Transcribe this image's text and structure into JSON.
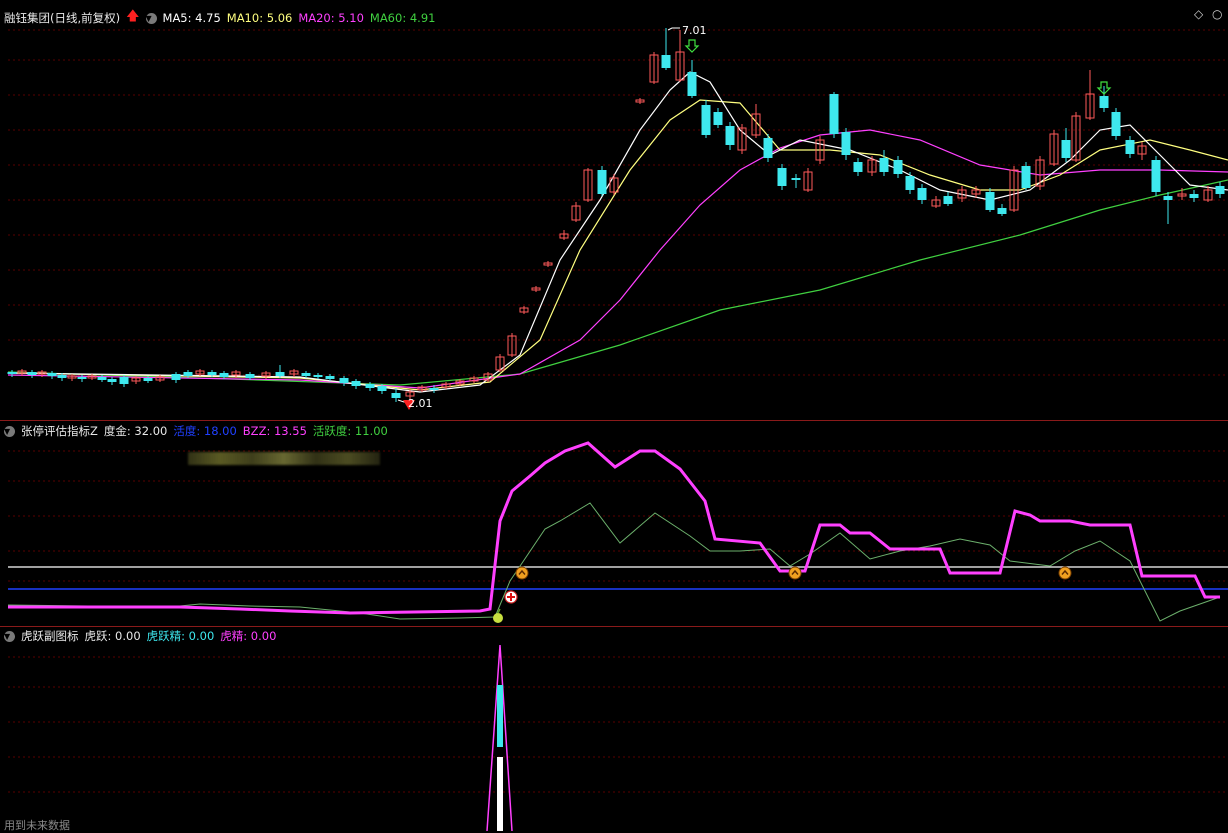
{
  "main": {
    "title": "融钰集团(日线,前复权)",
    "ma5": "MA5: 4.75",
    "ma10": "MA10: 5.06",
    "ma20": "MA20: 5.10",
    "ma60": "MA60: 4.91",
    "high_label": "7.01",
    "low_label": "2.01"
  },
  "indicator1": {
    "name": "张停评估指标Z",
    "du_jin": "度金: 32.00",
    "huo_du": "活度: 18.00",
    "bzz": "BZZ: 13.55",
    "huo_yue_du": "活跃度: 11.00"
  },
  "indicator2": {
    "name": "虎跃副图标",
    "hu_yue": "虎跃: 0.00",
    "hu_yue_jing": "虎跃精: 0.00",
    "hu_jing": "虎精: 0.00"
  },
  "footer": {
    "note": "用到未来数据"
  },
  "colors": {
    "up": "#ff5a5a",
    "down": "#3ee8ee",
    "ma5": "#ffffff",
    "ma10": "#ffff80",
    "ma20": "#ff40ff",
    "ma60": "#40d040",
    "purple_line": "#ff40ff",
    "thin_green": "#6cb06c",
    "blue_line": "#2040ff",
    "grid": "#5a0000"
  },
  "icons": [
    "up-arrow-icon",
    "collapse-circle-icon",
    "diamond-icon",
    "circle-icon",
    "orange-up-circle-icon",
    "red-plus-circle-icon",
    "apple-icon",
    "green-down-arrow-icon"
  ]
}
